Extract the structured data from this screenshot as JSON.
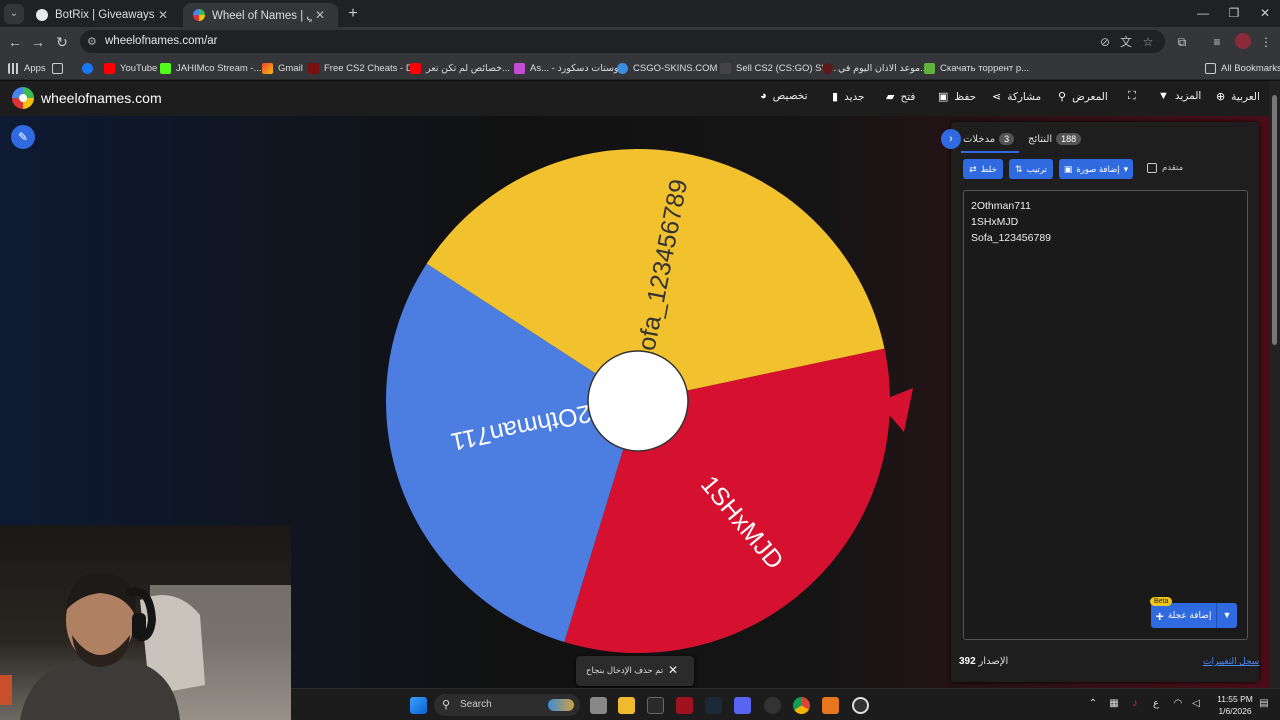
{
  "browser": {
    "tabs": [
      {
        "title": "BotRix | Giveaways",
        "active": false
      },
      {
        "title": "Wheel of Names | اسم العشوائي",
        "active": true
      }
    ],
    "url": "wheelofnames.com/ar",
    "bookmarks": [
      {
        "label": "Apps",
        "icon": "apps-grid-icon"
      },
      {
        "label": "",
        "icon": "grid-icon"
      },
      {
        "label": "",
        "icon": "facebook-icon"
      },
      {
        "label": "YouTube",
        "icon": "youtube-icon"
      },
      {
        "label": "JAHIMco Stream -...",
        "icon": "kick-icon"
      },
      {
        "label": "Gmail",
        "icon": "gmail-icon"
      },
      {
        "label": "Free CS2 Cheats - D...",
        "icon": "bookmark-site-icon"
      },
      {
        "label": "خصائص لم تكن تعر...",
        "icon": "youtube-icon"
      },
      {
        "label": "As... - بوستات دسكورد",
        "icon": "gem-icon"
      },
      {
        "label": "CSGO-SKINS.COM -...",
        "icon": "globe-icon"
      },
      {
        "label": "Sell CS2 (CS:GO) Ski...",
        "icon": "bookmark-site-icon"
      },
      {
        "label": "موعد الاذان اليوم في...",
        "icon": "bookmark-site-icon"
      },
      {
        "label": "Скачать торрент р...",
        "icon": "torrent-icon"
      }
    ],
    "all_bookmarks": "All Bookmarks"
  },
  "site": {
    "logo": "wheelofnames.com",
    "nav": [
      {
        "label": "تخصيص",
        "icon": "palette-icon"
      },
      {
        "label": "جديد",
        "icon": "file-icon"
      },
      {
        "label": "فتح",
        "icon": "folder-icon"
      },
      {
        "label": "حفظ",
        "icon": "save-icon"
      },
      {
        "label": "مشاركة",
        "icon": "share-icon"
      },
      {
        "label": "المعرض",
        "icon": "search-icon"
      },
      {
        "label": "",
        "icon": "fullscreen-icon"
      },
      {
        "label": "المزيد",
        "icon": "caret-down-icon"
      },
      {
        "label": "العربية",
        "icon": "globe-icon"
      }
    ]
  },
  "wheel": {
    "segments": [
      {
        "label": "Sofa_123456789",
        "color": "#f2c12e"
      },
      {
        "label": "1SHxMJD",
        "color": "#d6112f"
      },
      {
        "label": "2Othman711",
        "color": "#4c7de0"
      }
    ],
    "pointer_color": "#d6112f"
  },
  "panel": {
    "tabs": [
      {
        "label": "مدخلات",
        "count": "3"
      },
      {
        "label": "النتائج",
        "count": "188"
      }
    ],
    "buttons": {
      "shuffle": "خلط",
      "sort": "ترتيب",
      "add_image": "إضافة صورة"
    },
    "advanced": "متقدم",
    "entries": [
      "2Othman711",
      "1SHxMJD",
      "Sofa_123456789"
    ],
    "add_wheel": "إضافة عجلة",
    "beta": "Beta",
    "version_label": "الإصدار",
    "version": "392",
    "changelog": "سجل التغييرات"
  },
  "toast": {
    "message": "تم حذف الإدخال بنجاح"
  },
  "taskbar": {
    "search_placeholder": "Search",
    "language": "ع",
    "time": "11:55 PM",
    "date": "1/6/2026"
  }
}
